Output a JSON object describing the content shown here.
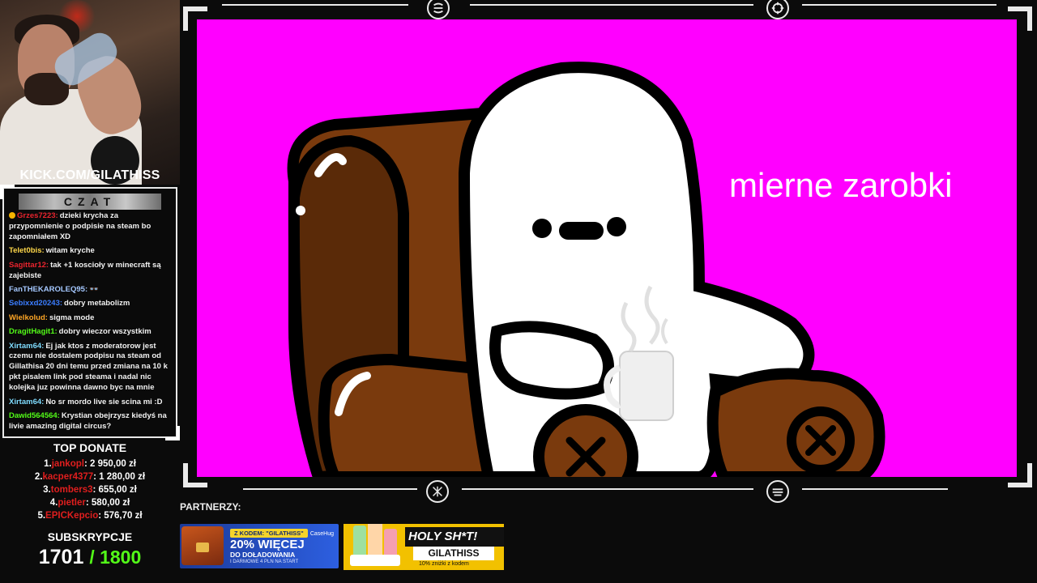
{
  "webcam": {
    "url": "KICK.COM/GILATHISS"
  },
  "chat": {
    "title": "CZAT",
    "messages": [
      {
        "user": "Grzes7223:",
        "color": "#e8242e",
        "badge": true,
        "text": "dzieki krycha za przypomnienie o podpisie na steam bo zapomniałem XD"
      },
      {
        "user": "Telet0bis:",
        "color": "#ffd84a",
        "badge": false,
        "text": "witam kryche"
      },
      {
        "user": "Sagittar12:",
        "color": "#e8242e",
        "badge": false,
        "text": "tak +1 kosciołу w minecraft są zajebiste"
      },
      {
        "user": "FanTHEKAROLEQ95:",
        "color": "#a5c8ff",
        "badge": false,
        "text": "👓"
      },
      {
        "user": "Sebixxd20243:",
        "color": "#3b7dff",
        "badge": false,
        "text": "dobry metabolizm"
      },
      {
        "user": "Wielkolud:",
        "color": "#ffa726",
        "badge": false,
        "text": "sigma mode"
      },
      {
        "user": "DragitHagit1:",
        "color": "#53fc18",
        "badge": false,
        "text": "dobry wieczor wszystkim"
      },
      {
        "user": "Xirtam64:",
        "color": "#7fdcff",
        "badge": false,
        "text": "Ej jak ktos z moderatorow jest czemu nie dostalem podpisu na steam od Gillathisa 20 dni temu przed zmiana na 10 k pkt pisalem link pod steama i nadal nic kolejka juz powinna dawno byc na mnie"
      },
      {
        "user": "Xirtam64:",
        "color": "#7fdcff",
        "badge": false,
        "text": "No sr mordo live sie scina mi :D"
      },
      {
        "user": "Dawid564564:",
        "color": "#53fc18",
        "badge": false,
        "text": "Krystian obejrzysz kiedyś na livie amazing digital circus?"
      }
    ]
  },
  "top_donate": {
    "title": "TOP DONATE",
    "entries": [
      {
        "rank": "1.",
        "name": "jankopl",
        "amount": ": 2 950,00 zł"
      },
      {
        "rank": "2.",
        "name": "kacper4377",
        "amount": ": 1 280,00 zł"
      },
      {
        "rank": "3.",
        "name": "tombers3",
        "amount": ": 655,00 zł"
      },
      {
        "rank": "4.",
        "name": "pietler",
        "amount": ": 580,00 zł"
      },
      {
        "rank": "5.",
        "name": "EPICKepcio",
        "amount": ": 576,70 zł"
      }
    ]
  },
  "subscriptions": {
    "title": "SUBSKRYPCJE",
    "current": "1701",
    "goal": "/ 1800"
  },
  "video": {
    "caption": "mierne zarobki"
  },
  "partners": {
    "label": "PARTNERZY:",
    "banner1": {
      "code": "Z KODEM: \"GILATHISS\"",
      "headline": "20% WIĘCEJ",
      "sub": "DO DOŁADOWANIA",
      "foot": "I DARMOWE 4 PLN NA START",
      "brand": "CaseHug"
    },
    "banner2": {
      "headline": "HOLY SH*T!",
      "code": "GILATHISS",
      "foot": "10% zniżki z kodem"
    }
  },
  "colors": {
    "magenta": "#ff00ff",
    "kick_green": "#53fc18",
    "donor_red": "#e01e1e"
  }
}
